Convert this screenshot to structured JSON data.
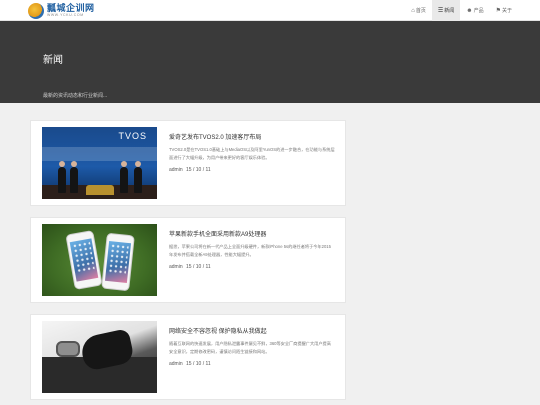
{
  "header": {
    "logo_cn": "瓢城企训网",
    "logo_en": "WWW.YCKU.COM",
    "nav": [
      {
        "label": "首页",
        "icon": "home-icon",
        "active": false
      },
      {
        "label": "新闻",
        "icon": "list-icon",
        "active": true
      },
      {
        "label": "产品",
        "icon": "user-icon",
        "active": false
      },
      {
        "label": "关于",
        "icon": "tag-icon",
        "active": false
      }
    ]
  },
  "hero": {
    "title": "新闻",
    "subtitle": "最新的资讯动态和行业新闻..."
  },
  "articles": [
    {
      "title": "爱奇艺发布TVOS2.0 加速客厅布局",
      "excerpt": "TVOS2.0是在TVOS1.0基础上与MediaOS以及阿里YunOS的进一步融合，在功能与系统层面进行了大幅升级，为用户带来更好的客厅娱乐体验。",
      "author": "admin",
      "date": "15 / 10 / 11",
      "thumb_text": "TVOS"
    },
    {
      "title": "苹果新款手机全面采用新款A9处理器",
      "excerpt": "据悉，苹果公司将在新一代产品上全面升级硬件，新款iPhone 5s的继任者将于今年2015年发布并搭载全新A9处理器，性能大幅提升。",
      "author": "admin",
      "date": "15 / 10 / 11"
    },
    {
      "title": "网络安全不容忽视 保护隐私从我做起",
      "excerpt": "随着互联网的快速发展，用户隐私泄露事件屡见不鲜，360等安全厂商提醒广大用户提高安全意识，定期修改密码，谨慎访问陌生链接和网站。",
      "author": "admin",
      "date": "15 / 10 / 11"
    }
  ],
  "colors": {
    "hero_bg": "#3a3a3a",
    "page_bg": "#f0f0f0",
    "card_bg": "#ffffff",
    "logo_blue": "#1f5fa0"
  }
}
